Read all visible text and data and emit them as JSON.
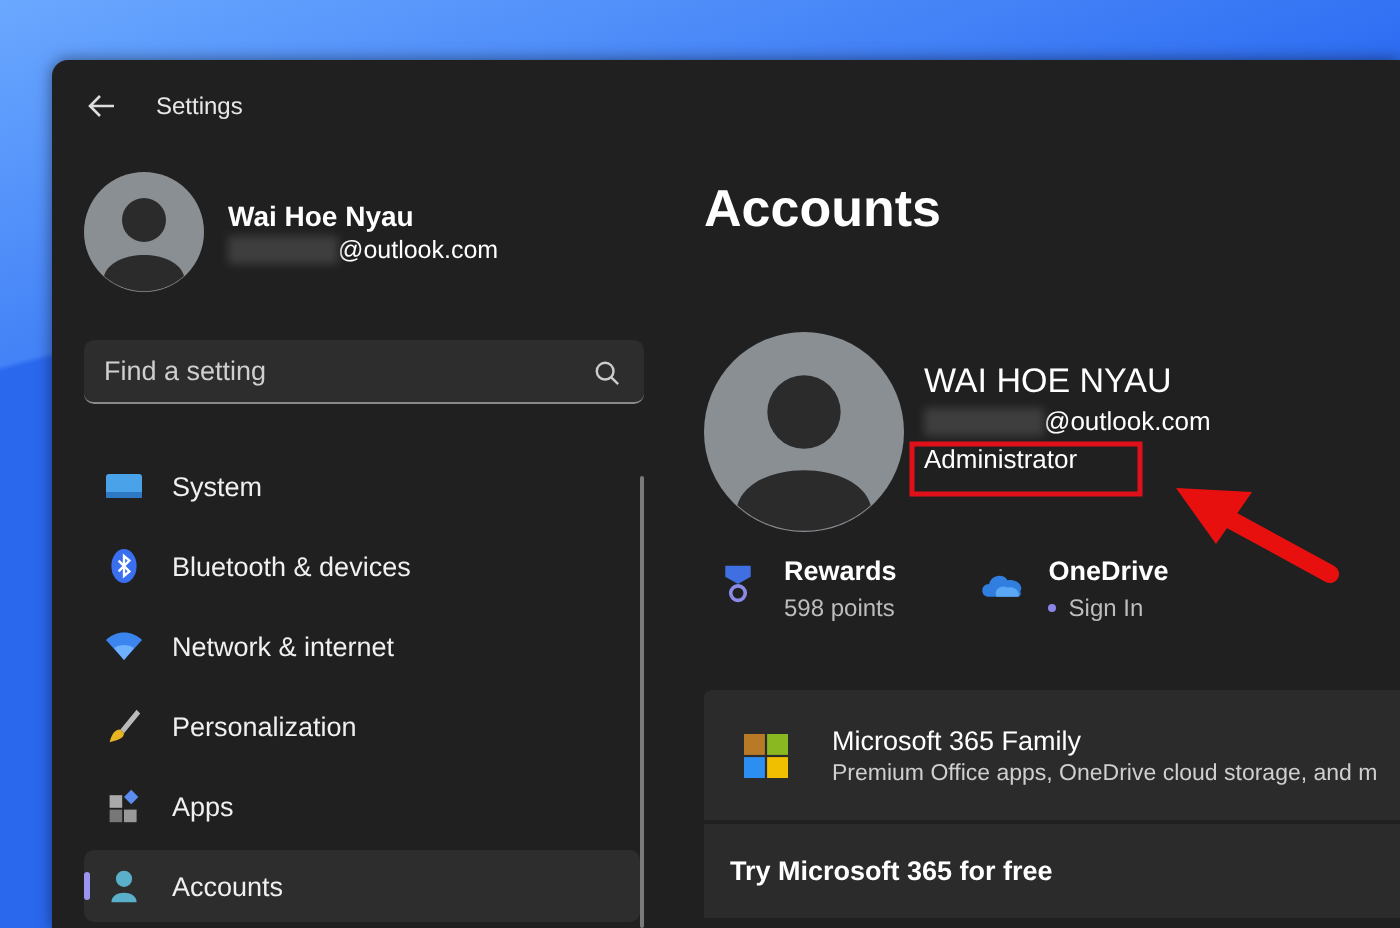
{
  "window": {
    "title": "Settings"
  },
  "profile": {
    "name": "Wai Hoe Nyau",
    "email": "@outlook.com"
  },
  "search": {
    "placeholder": "Find a setting"
  },
  "nav": [
    {
      "label": "System",
      "selected": false
    },
    {
      "label": "Bluetooth & devices",
      "selected": false
    },
    {
      "label": "Network & internet",
      "selected": false
    },
    {
      "label": "Personalization",
      "selected": false
    },
    {
      "label": "Apps",
      "selected": false
    },
    {
      "label": "Accounts",
      "selected": true
    }
  ],
  "page": {
    "title": "Accounts",
    "account": {
      "name": "WAI HOE NYAU",
      "email": "@outlook.com",
      "role": "Administrator"
    },
    "services": [
      {
        "title": "Rewards",
        "detail": "598 points"
      },
      {
        "title": "OneDrive",
        "detail": "Sign In"
      }
    ],
    "cards": [
      {
        "kind": "product",
        "title": "Microsoft 365 Family",
        "subtitle": "Premium Office apps, OneDrive cloud storage, and m"
      },
      {
        "kind": "offer",
        "title": "Try Microsoft 365 for free"
      }
    ]
  }
}
